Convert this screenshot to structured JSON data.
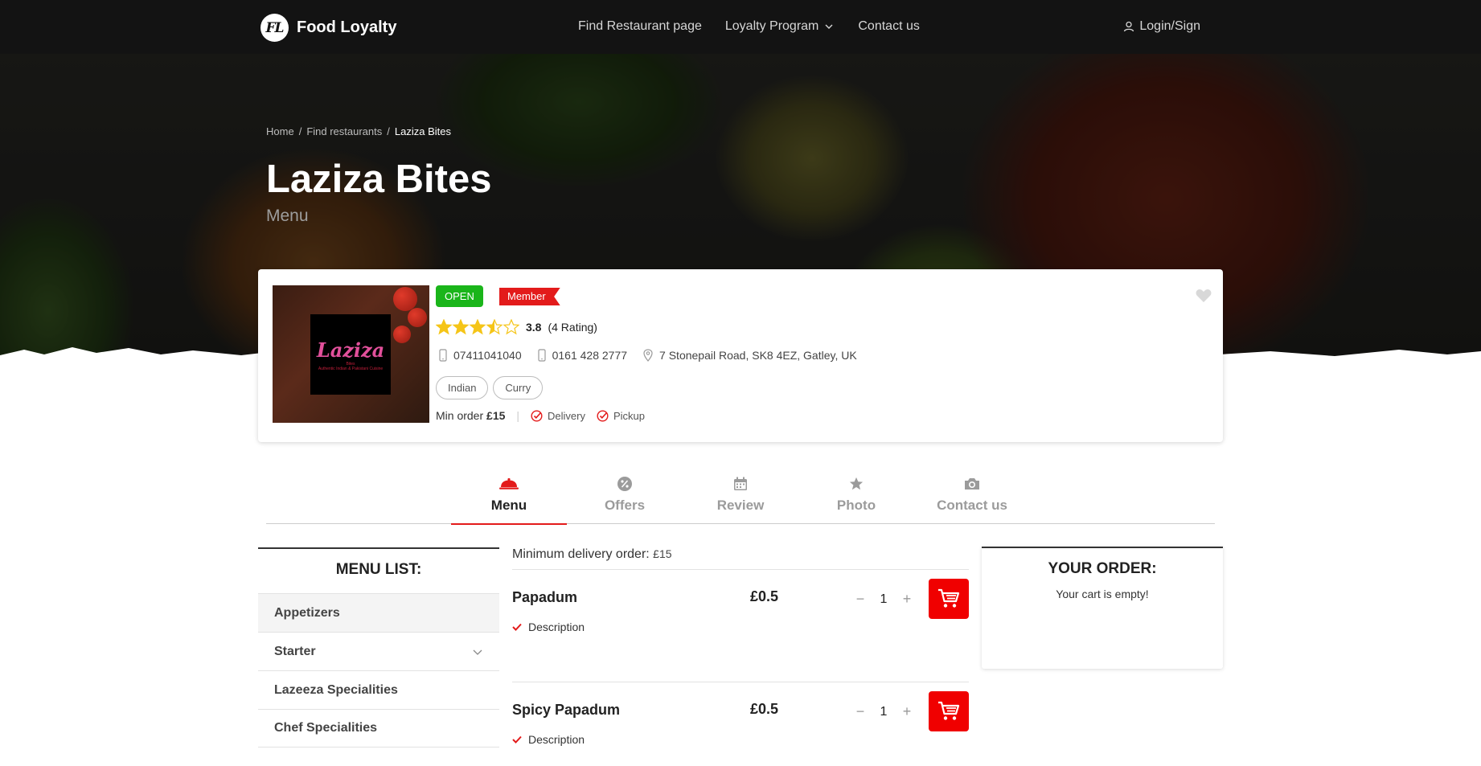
{
  "nav": {
    "logo_mark": "FL",
    "logo_text": "Food Loyalty",
    "links": [
      {
        "label": "Find Restaurant page"
      },
      {
        "label": "Loyalty Program"
      },
      {
        "label": "Contact us"
      }
    ],
    "login_label": "Login/Sign"
  },
  "hero": {
    "breadcrumb": [
      "Home",
      "Find restaurants",
      "Laziza Bites"
    ],
    "title": "Laziza Bites",
    "subtitle": "Menu"
  },
  "restaurant": {
    "status": "OPEN",
    "membership": "Member",
    "rating_value": 3.5,
    "rating_score": "3.8",
    "rating_count": "(4 Rating)",
    "phone_mobile": "07411041040",
    "phone_landline": "0161 428 2777",
    "address": "7 Stonepail Road, SK8 4EZ, Gatley, UK",
    "tags": [
      "Indian",
      "Curry"
    ],
    "min_order_label": "Min order",
    "min_order_value": "£15",
    "options": [
      "Delivery",
      "Pickup"
    ],
    "logo_word": "Laziza",
    "logo_small": "Bites",
    "logo_tagline": "Authentic Indian & Pakistani Cuisine"
  },
  "tabs": [
    {
      "label": "Menu",
      "icon": "cloche-icon",
      "active": true
    },
    {
      "label": "Offers",
      "icon": "percent-badge-icon",
      "active": false
    },
    {
      "label": "Review",
      "icon": "calendar-icon",
      "active": false
    },
    {
      "label": "Photo",
      "icon": "star-icon",
      "active": false
    },
    {
      "label": "Contact us",
      "icon": "camera-icon",
      "active": false
    }
  ],
  "menu_list": {
    "title": "MENU LIST:",
    "items": [
      {
        "label": "Appetizers"
      },
      {
        "label": "Starter"
      },
      {
        "label": "Lazeeza Specialities"
      },
      {
        "label": "Chef Specialities"
      }
    ]
  },
  "center": {
    "min_delivery_label": "Minimum delivery order:",
    "min_delivery_value": "£15",
    "products": [
      {
        "name": "Papadum",
        "price": "£0.5",
        "qty": "1",
        "desc": "Description"
      },
      {
        "name": "Spicy Papadum",
        "price": "£0.5",
        "qty": "1",
        "desc": "Description"
      }
    ],
    "qty_minus": "−",
    "qty_plus": "+"
  },
  "order": {
    "title": "YOUR ORDER:",
    "empty": "Your cart is empty!"
  },
  "colors": {
    "nav_bg": "#131313",
    "accent_red": "#f00000",
    "open_green": "#1ab51a",
    "star_yellow": "#f5c518"
  }
}
